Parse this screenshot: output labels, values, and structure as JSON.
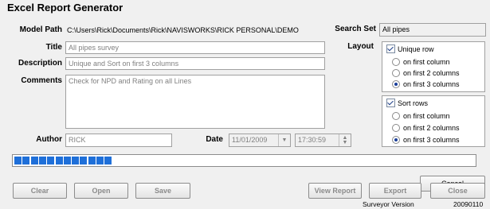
{
  "window": {
    "title": "Excel Report Generator"
  },
  "labels": {
    "model_path": "Model Path",
    "search_set": "Search Set",
    "title": "Title",
    "layout": "Layout",
    "description": "Description",
    "comments": "Comments",
    "author": "Author",
    "date": "Date"
  },
  "fields": {
    "model_path": "C:\\Users\\Rick\\Documents\\Rick\\NAVISWORKS\\RICK PERSONAL\\DEMO",
    "search_set": "All pipes",
    "title": "All pipes survey",
    "description": "Unique and Sort on first 3 columns",
    "comments": "Check for NPD and Rating on all Lines",
    "author": "RICK",
    "date": "11/01/2009",
    "time": "17:30:59"
  },
  "layout": {
    "unique_row": {
      "label": "Unique row",
      "checked": true,
      "options": [
        "on first column",
        "on first 2 columns",
        "on first 3 columns"
      ],
      "selected": 2
    },
    "sort_rows": {
      "label": "Sort rows",
      "checked": true,
      "options": [
        "on first column",
        "on first 2 columns",
        "on first 3 columns"
      ],
      "selected": 2
    }
  },
  "progress": {
    "filled_segments": 12,
    "fraction": 0.22
  },
  "buttons": {
    "cancel": "Cancel",
    "clear": "Clear",
    "open": "Open",
    "save": "Save",
    "view_report": "View Report",
    "export": "Export",
    "close": "Close"
  },
  "footer": {
    "version_label": "Surveyor Version",
    "version": "20090110"
  },
  "colors": {
    "progress": "#1e6fd9",
    "background": "#f0f0f0"
  }
}
